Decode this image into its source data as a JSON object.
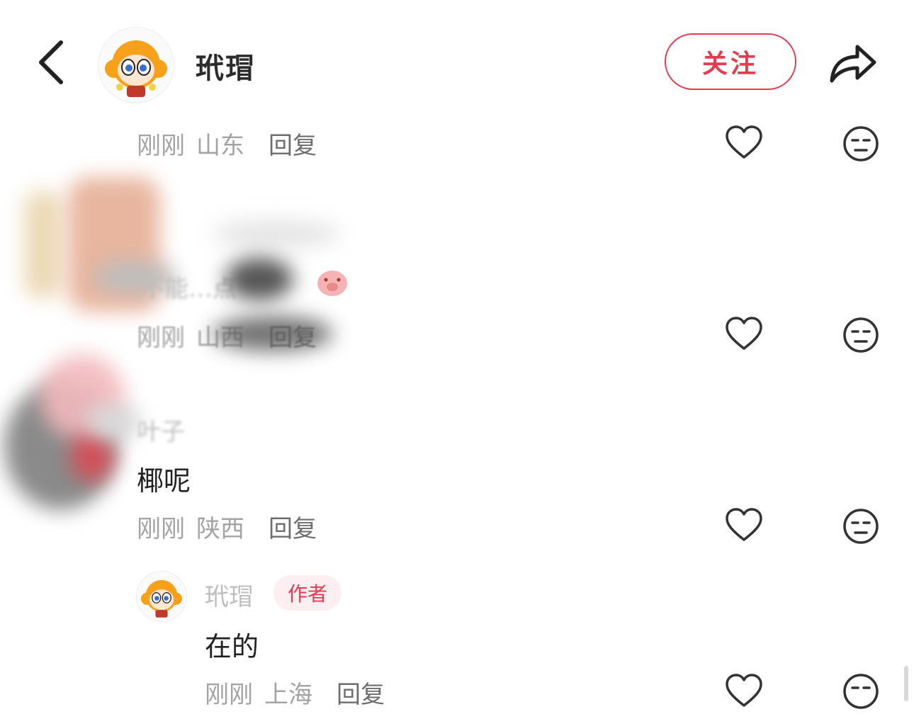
{
  "header": {
    "author_name": "玳瑁",
    "follow_label": "关注"
  },
  "comments": [
    {
      "meta": {
        "time": "刚刚",
        "location": "山东",
        "reply": "回复"
      }
    },
    {
      "text": "不能…点",
      "meta": {
        "time": "刚刚",
        "location": "山西",
        "reply": "回复"
      }
    },
    {
      "commenter": "叶子",
      "text": "椰呢",
      "meta": {
        "time": "刚刚",
        "location": "陕西",
        "reply": "回复"
      },
      "replies": [
        {
          "commenter": "玳瑁",
          "badge": "作者",
          "text": "在的",
          "meta": {
            "time": "刚刚",
            "location": "上海",
            "reply": "回复"
          }
        }
      ]
    }
  ],
  "colors": {
    "accent": "#e63b4f",
    "meta_text": "#a3a3a3",
    "reply_text": "#6d6d6d"
  },
  "icons": [
    "back-icon",
    "share-icon",
    "heart-icon",
    "dislike-face-icon"
  ]
}
